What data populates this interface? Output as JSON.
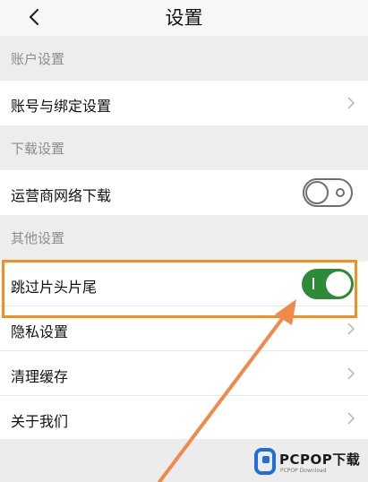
{
  "header": {
    "title": "设置",
    "back_icon": "chevron-left-icon"
  },
  "sections": {
    "account": "账户设置",
    "download": "下载设置",
    "other": "其他设置"
  },
  "rows": {
    "account_binding": "账号与绑定设置",
    "carrier_download": {
      "label": "运营商网络下载",
      "enabled": false
    },
    "skip_intro": {
      "label": "跳过片头片尾",
      "enabled": true
    },
    "privacy": "隐私设置",
    "clear_cache": "清理缓存",
    "about": "关于我们"
  },
  "watermark": {
    "brand": "PCPOP下载",
    "sub": "PCPOP Download"
  },
  "colors": {
    "toggle_on": "#2d8a36",
    "highlight": "#f0901e",
    "arrow": "#f08a4b"
  }
}
